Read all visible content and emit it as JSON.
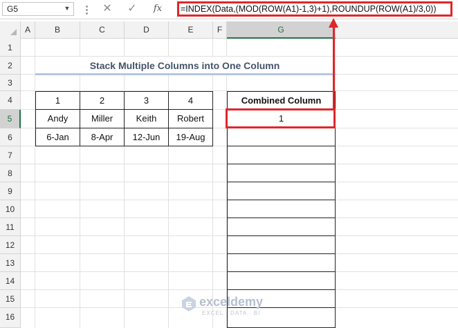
{
  "formula_bar": {
    "name_box": "G5",
    "cancel_glyph": "✕",
    "enter_glyph": "✓",
    "fx_label": "fx",
    "formula": "=INDEX(Data,(MOD(ROW(A1)-1,3)+1),ROUNDUP(ROW(A1)/3,0))"
  },
  "columns": [
    "A",
    "B",
    "C",
    "D",
    "E",
    "F",
    "G"
  ],
  "rows": [
    "1",
    "2",
    "3",
    "4",
    "5",
    "6",
    "7",
    "8",
    "9",
    "10",
    "11",
    "12",
    "13",
    "14",
    "15",
    "16"
  ],
  "selected": {
    "column": "G",
    "row": "5"
  },
  "title": "Stack Multiple Columns into One Column",
  "data_table": {
    "headers": [
      "1",
      "2",
      "3",
      "4"
    ],
    "rows": [
      [
        "Andy",
        "Miller",
        "Keith",
        "Robert"
      ],
      [
        "6-Jan",
        "8-Apr",
        "12-Jun",
        "19-Aug"
      ]
    ]
  },
  "combined": {
    "header": "Combined Column",
    "values": [
      "1",
      "",
      "",
      "",
      "",
      "",
      "",
      "",
      "",
      "",
      "",
      ""
    ]
  },
  "watermark": {
    "name": "exceldemy",
    "tagline": "EXCEL · DATA · BI"
  },
  "colors": {
    "highlight_border": "#e0262a",
    "title_underline": "#b4c6e7",
    "selection_header": "#217346"
  }
}
